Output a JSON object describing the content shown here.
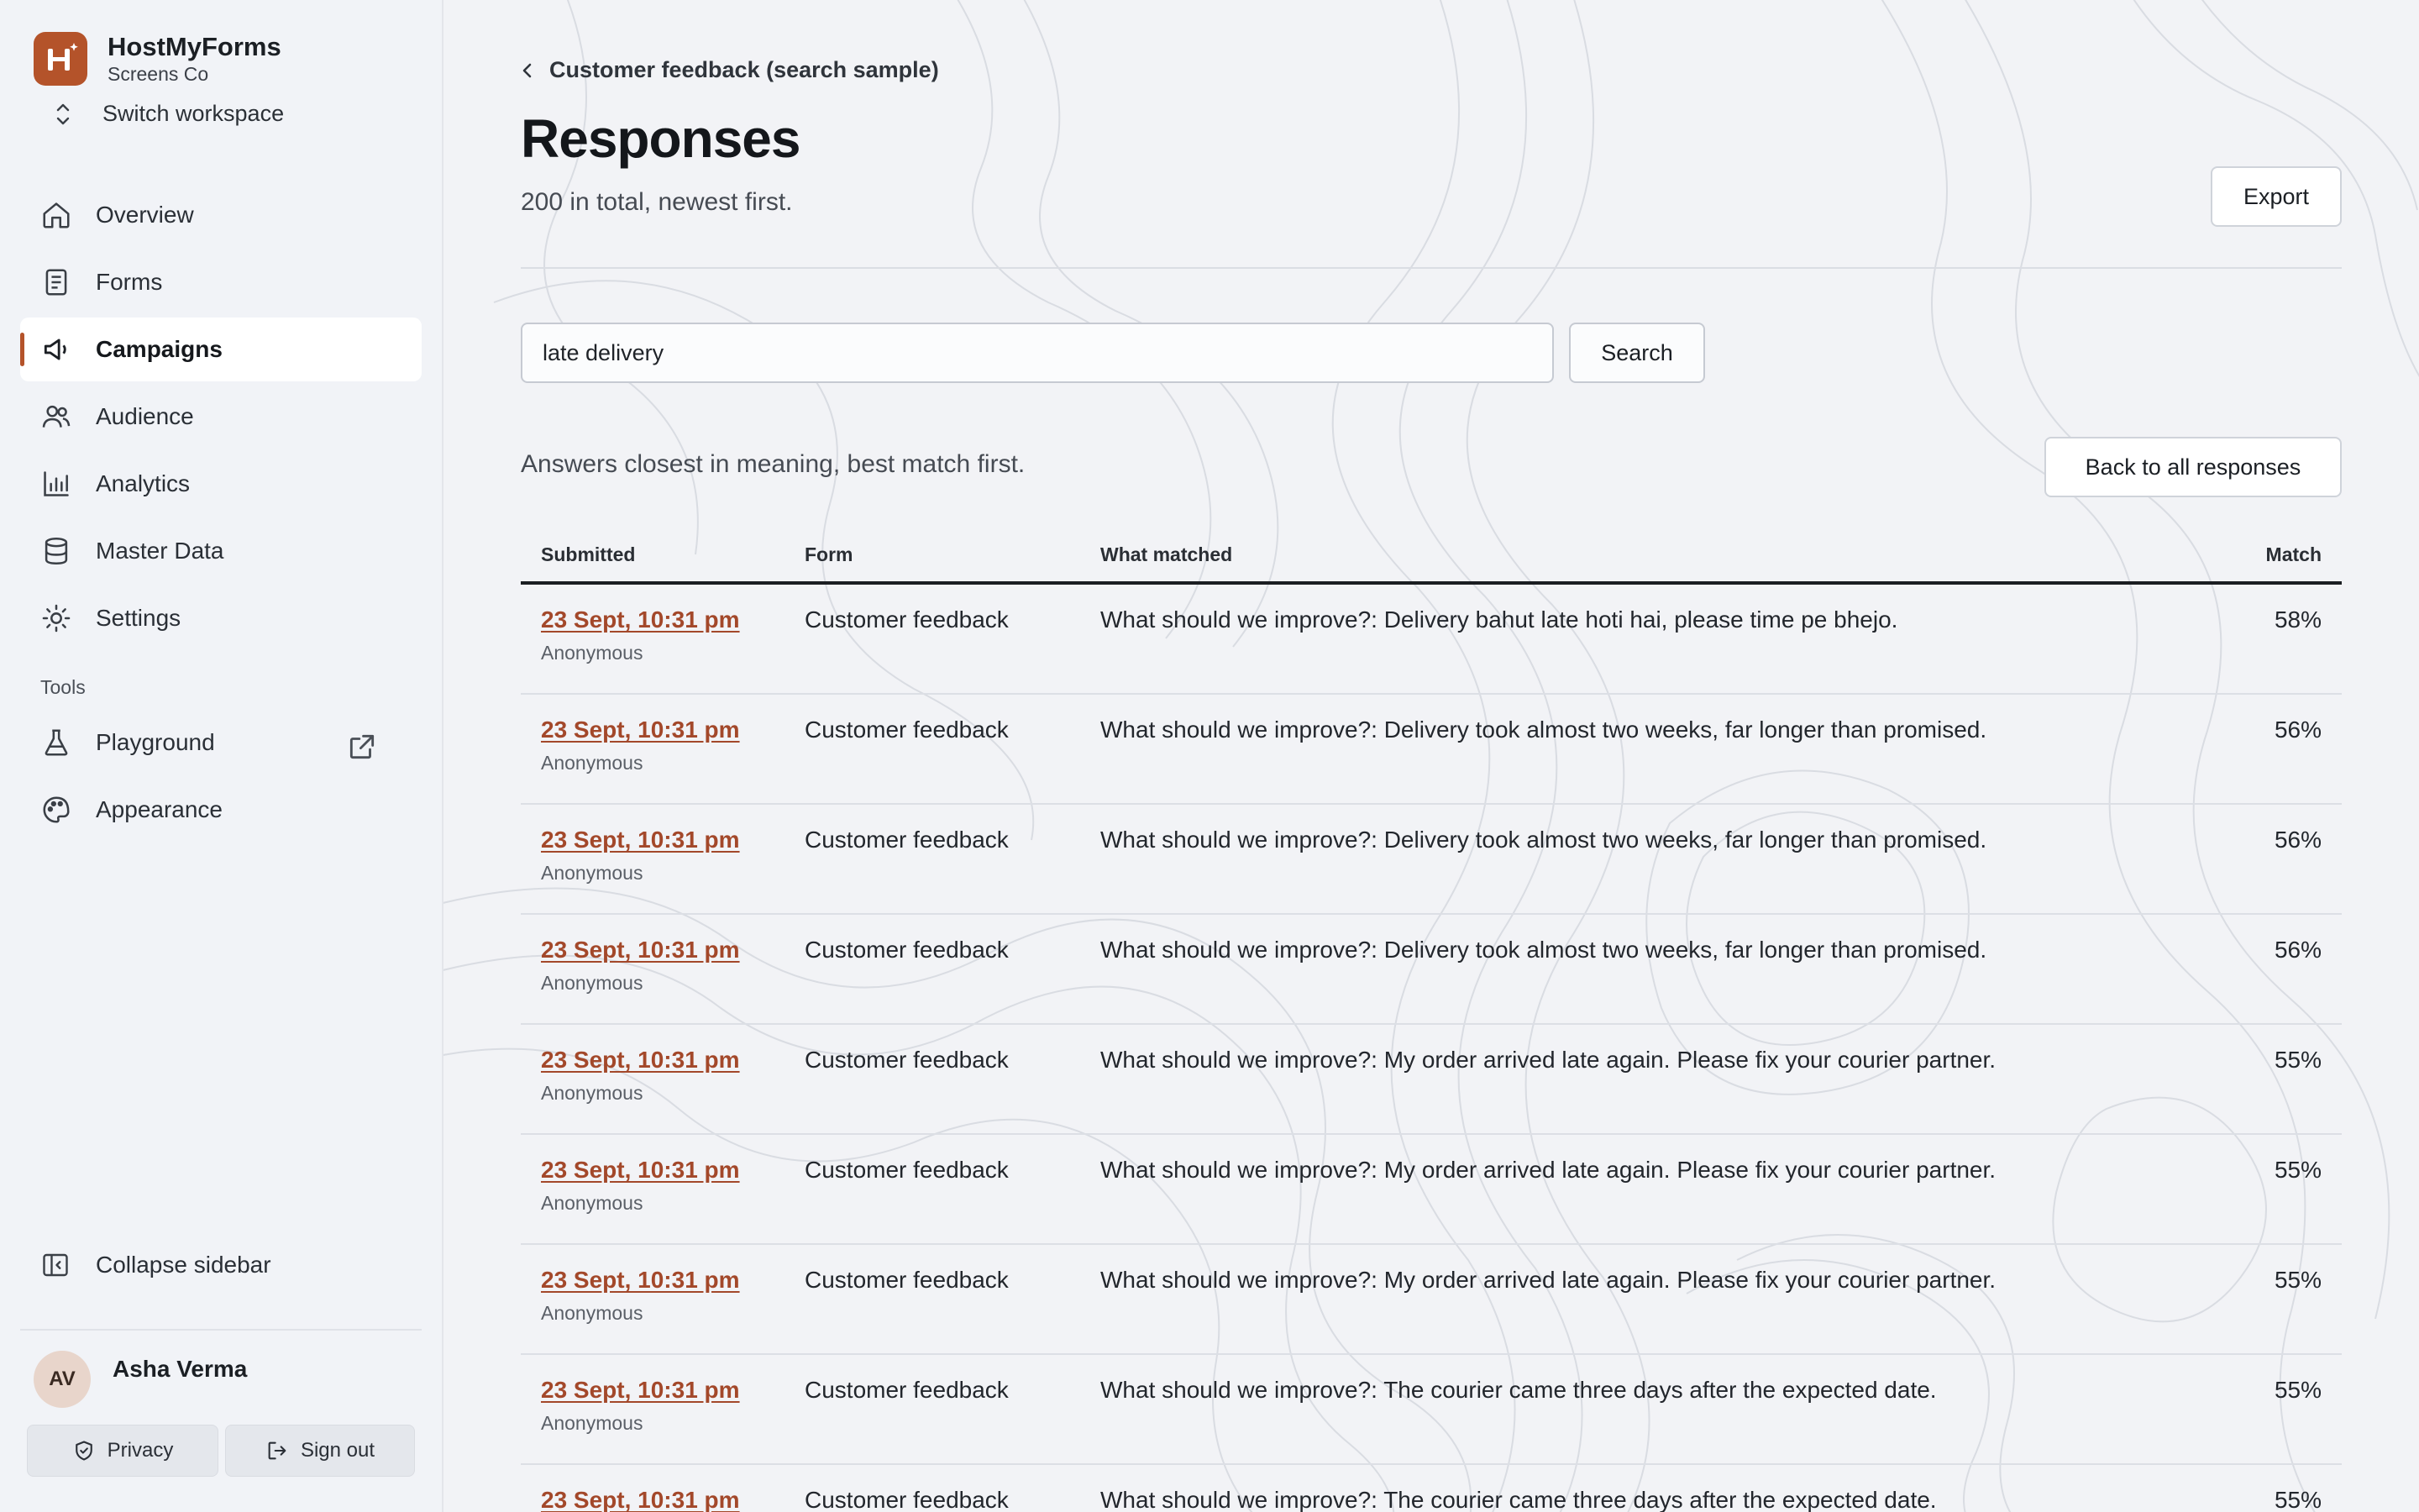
{
  "brand": {
    "name": "HostMyForms",
    "workspace": "Screens Co",
    "switch_label": "Switch workspace"
  },
  "nav": {
    "items": [
      {
        "label": "Overview",
        "icon": "home-icon",
        "active": false
      },
      {
        "label": "Forms",
        "icon": "document-icon",
        "active": false
      },
      {
        "label": "Campaigns",
        "icon": "megaphone-icon",
        "active": true
      },
      {
        "label": "Audience",
        "icon": "users-icon",
        "active": false
      },
      {
        "label": "Analytics",
        "icon": "bar-chart-icon",
        "active": false
      },
      {
        "label": "Master Data",
        "icon": "database-icon",
        "active": false
      },
      {
        "label": "Settings",
        "icon": "gear-icon",
        "active": false
      }
    ],
    "tools_label": "Tools",
    "tools": [
      {
        "label": "Playground",
        "icon": "flask-icon",
        "external": true
      },
      {
        "label": "Appearance",
        "icon": "palette-icon",
        "external": false
      }
    ]
  },
  "sidebar_footer": {
    "collapse_label": "Collapse sidebar",
    "user_initials": "AV",
    "user_name": "Asha Verma",
    "privacy_label": "Privacy",
    "signout_label": "Sign out"
  },
  "page": {
    "breadcrumb": "Customer feedback (search sample)",
    "title": "Responses",
    "subtitle": "200 in total, newest first.",
    "export_label": "Export",
    "search_value": "late delivery",
    "search_button": "Search",
    "result_desc": "Answers closest in meaning, best match first.",
    "back_label": "Back to all responses"
  },
  "table": {
    "headers": {
      "submitted": "Submitted",
      "form": "Form",
      "what": "What matched",
      "match": "Match"
    },
    "rows": [
      {
        "date": "23 Sept, 10:31 pm",
        "who": "Anonymous",
        "form": "Customer feedback",
        "what": "What should we improve?: Delivery bahut late hoti hai, please time pe bhejo.",
        "match": "58%"
      },
      {
        "date": "23 Sept, 10:31 pm",
        "who": "Anonymous",
        "form": "Customer feedback",
        "what": "What should we improve?: Delivery took almost two weeks, far longer than promised.",
        "match": "56%"
      },
      {
        "date": "23 Sept, 10:31 pm",
        "who": "Anonymous",
        "form": "Customer feedback",
        "what": "What should we improve?: Delivery took almost two weeks, far longer than promised.",
        "match": "56%"
      },
      {
        "date": "23 Sept, 10:31 pm",
        "who": "Anonymous",
        "form": "Customer feedback",
        "what": "What should we improve?: Delivery took almost two weeks, far longer than promised.",
        "match": "56%"
      },
      {
        "date": "23 Sept, 10:31 pm",
        "who": "Anonymous",
        "form": "Customer feedback",
        "what": "What should we improve?: My order arrived late again. Please fix your courier partner.",
        "match": "55%"
      },
      {
        "date": "23 Sept, 10:31 pm",
        "who": "Anonymous",
        "form": "Customer feedback",
        "what": "What should we improve?: My order arrived late again. Please fix your courier partner.",
        "match": "55%"
      },
      {
        "date": "23 Sept, 10:31 pm",
        "who": "Anonymous",
        "form": "Customer feedback",
        "what": "What should we improve?: My order arrived late again. Please fix your courier partner.",
        "match": "55%"
      },
      {
        "date": "23 Sept, 10:31 pm",
        "who": "Anonymous",
        "form": "Customer feedback",
        "what": "What should we improve?: The courier came three days after the expected date.",
        "match": "55%"
      },
      {
        "date": "23 Sept, 10:31 pm",
        "who": "",
        "form": "Customer feedback",
        "what": "What should we improve?: The courier came three days after the expected date.",
        "match": "55%"
      }
    ]
  },
  "colors": {
    "accent": "#b4532a",
    "link": "#a3482a",
    "sidebar_bg": "#f1f3f7",
    "main_bg": "#f2f3f6"
  }
}
